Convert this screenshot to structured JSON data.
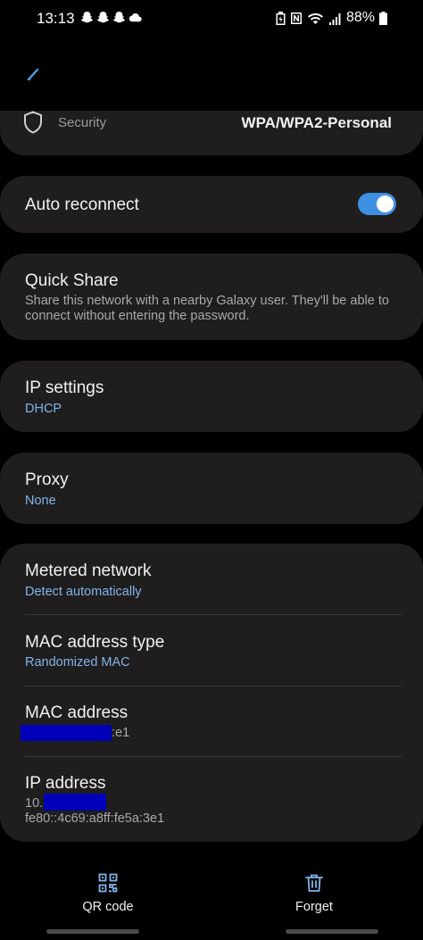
{
  "status_bar": {
    "time": "13:13",
    "battery": "88%"
  },
  "network": {
    "security_label": "Security",
    "security_value": "WPA/WPA2-Personal",
    "auto_reconnect_label": "Auto reconnect",
    "auto_reconnect_on": true,
    "quick_share_title": "Quick Share",
    "quick_share_desc": "Share this network with a nearby Galaxy user. They'll be able to connect without entering the password.",
    "ip_settings_title": "IP settings",
    "ip_settings_value": "DHCP",
    "proxy_title": "Proxy",
    "proxy_value": "None",
    "metered_title": "Metered network",
    "metered_value": "Detect automatically",
    "mac_type_title": "MAC address type",
    "mac_type_value": "Randomized MAC",
    "mac_address_title": "MAC address",
    "mac_address_visible_suffix": ":e1",
    "ip_address_title": "IP address",
    "ip_address_visible_prefix": "10.",
    "ipv6_address": "fe80::4c69:a8ff:fe5a:3e1"
  },
  "bottom_actions": {
    "qr_label": "QR code",
    "forget_label": "Forget"
  },
  "colors": {
    "accent": "#3e91e2",
    "card_bg": "#1f1d1d",
    "subtitle_blue": "#7fb5ea",
    "redaction": "#0000b8"
  }
}
